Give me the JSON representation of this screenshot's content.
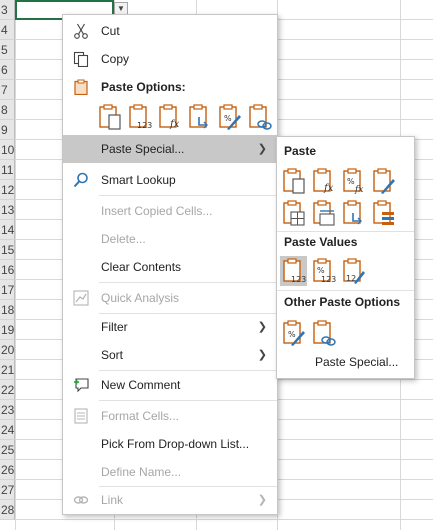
{
  "sheet": {
    "row_numbers": [
      "3",
      "4",
      "5",
      "6",
      "7",
      "8",
      "9",
      "10",
      "11",
      "12",
      "13",
      "14",
      "15",
      "16",
      "17",
      "18",
      "19",
      "20",
      "21",
      "22",
      "23",
      "24",
      "25",
      "26",
      "27",
      "28"
    ]
  },
  "context_menu": {
    "cut": "Cut",
    "copy": "Copy",
    "paste_options": "Paste Options:",
    "paste_special": "Paste Special...",
    "smart_lookup": "Smart Lookup",
    "insert_copied_cells": "Insert Copied Cells...",
    "delete": "Delete...",
    "clear_contents": "Clear Contents",
    "quick_analysis": "Quick Analysis",
    "filter": "Filter",
    "sort": "Sort",
    "new_comment": "New Comment",
    "format_cells": "Format Cells...",
    "pick_from_list": "Pick From Drop-down List...",
    "define_name": "Define Name...",
    "link": "Link",
    "submenu_arrow": "❯"
  },
  "submenu": {
    "paste": "Paste",
    "paste_values": "Paste Values",
    "other_paste_options": "Other Paste Options",
    "paste_special": "Paste Special..."
  },
  "colors": {
    "accent_orange": "#c4600f",
    "accent_blue": "#2e75b6",
    "highlight": "#c8c8c8",
    "excel_green": "#217346"
  }
}
